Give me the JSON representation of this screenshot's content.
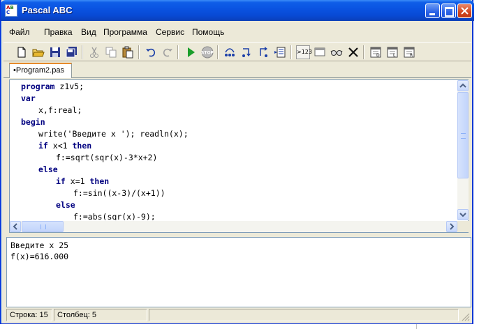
{
  "window": {
    "title": "Pascal ABC",
    "icon": "pascal-abc-app-icon",
    "icon_letters": [
      "A",
      "B",
      "C"
    ],
    "colors": {
      "titlebar": "#0a54e2",
      "face": "#ece9d8",
      "keyword": "#000080"
    }
  },
  "menu": {
    "items": [
      "Файл",
      "Правка",
      "Вид",
      "Программа",
      "Сервис",
      "Помощь"
    ]
  },
  "toolbar": {
    "buttons": [
      "new-file-icon",
      "open-folder-icon",
      "save-icon",
      "save-all-icon",
      "cut-icon",
      "copy-icon",
      "paste-icon",
      "undo-icon",
      "redo-icon",
      "run-icon",
      "stop-icon",
      "step-over-icon",
      "step-into-icon",
      "step-out-icon",
      "watch-list-icon",
      "eval-expression-icon",
      "window-icon",
      "glasses-icon",
      "delete-icon",
      "debug-window-1-icon",
      "debug-window-2-icon",
      "debug-window-3-icon"
    ],
    "eval_label": ">123"
  },
  "tabs": [
    {
      "label": "•Program2.pas",
      "active": true
    }
  ],
  "editor": {
    "lines": [
      {
        "indent": 0,
        "kw": "program",
        "text": " z1v5;"
      },
      {
        "indent": 0,
        "kw": "var",
        "text": ""
      },
      {
        "indent": 1,
        "kw": "",
        "text": "x,f:real;"
      },
      {
        "indent": 0,
        "kw": "begin",
        "text": ""
      },
      {
        "indent": 1,
        "kw": "",
        "text": "write('Введите x '); readln(x);"
      },
      {
        "indent": 1,
        "kw": "if",
        "text": " x<1 ",
        "kw2": "then"
      },
      {
        "indent": 2,
        "kw": "",
        "text": "f:=sqrt(sqr(x)-3*x+2)"
      },
      {
        "indent": 1,
        "kw": "else",
        "text": ""
      },
      {
        "indent": 2,
        "kw": "if",
        "text": " x=1 ",
        "kw2": "then"
      },
      {
        "indent": 3,
        "kw": "",
        "text": "f:=sin((x-3)/(x+1))"
      },
      {
        "indent": 2,
        "kw": "else",
        "text": ""
      },
      {
        "indent": 3,
        "kw": "",
        "text": "f:=abs(sqr(x)-9);"
      }
    ]
  },
  "output": {
    "lines": [
      "Введите x 25",
      "f(x)=616.000"
    ]
  },
  "status": {
    "row_label": "Строка: 15",
    "col_label": "Столбец: 5"
  }
}
